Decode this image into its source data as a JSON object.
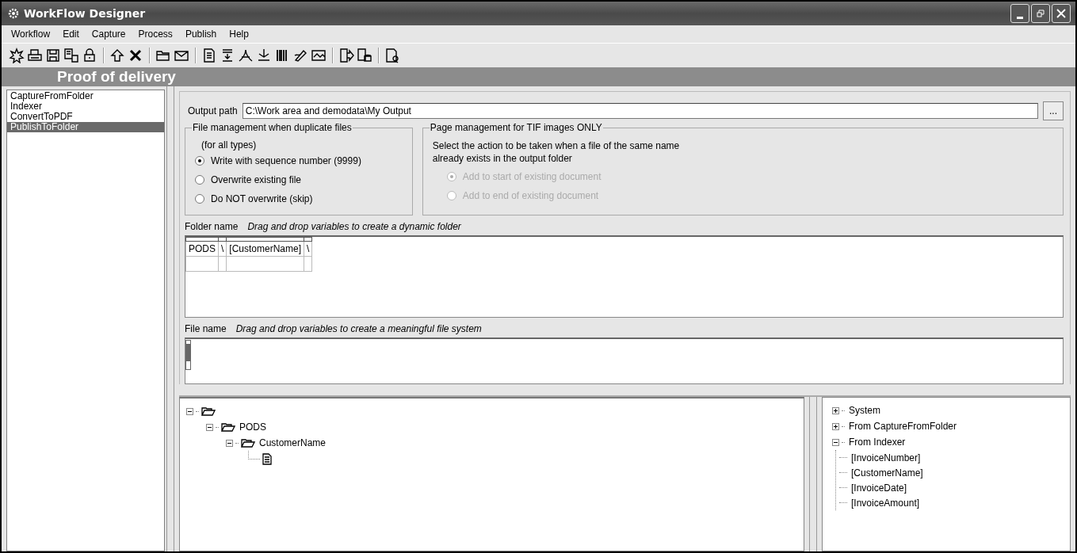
{
  "window": {
    "title": "WorkFlow Designer"
  },
  "menu": [
    "Workflow",
    "Edit",
    "Capture",
    "Process",
    "Publish",
    "Help"
  ],
  "header": {
    "title": "Proof of delivery"
  },
  "steps": [
    {
      "label": "CaptureFromFolder",
      "selected": false
    },
    {
      "label": "Indexer",
      "selected": false
    },
    {
      "label": "ConvertToPDF",
      "selected": false
    },
    {
      "label": "PublishToFolder",
      "selected": true
    }
  ],
  "output_path": {
    "label": "Output path",
    "value": "C:\\Work area and demodata\\My Output",
    "browse": "..."
  },
  "duplicates": {
    "title": "File management when duplicate files",
    "note": "(for all types)",
    "options": [
      {
        "label": "Write with sequence number (9999)",
        "selected": true
      },
      {
        "label": "Overwrite existing file",
        "selected": false
      },
      {
        "label": "Do NOT overwrite (skip)",
        "selected": false
      }
    ]
  },
  "tif": {
    "title": "Page management for TIF images ONLY",
    "description": "Select the action to be taken when a file of the same name already exists in the output folder",
    "disabled": true,
    "options": [
      {
        "label": "Add to start of existing document",
        "selected": true
      },
      {
        "label": "Add to end of existing document",
        "selected": false
      }
    ]
  },
  "folder_name": {
    "label": "Folder name",
    "hint": "Drag and drop variables to create a dynamic folder",
    "segments": [
      "PODS",
      "\\",
      "[CustomerName]",
      "\\"
    ]
  },
  "file_name": {
    "label": "File name",
    "hint": "Drag and drop variables to create a meaningful file system"
  },
  "folder_tree": [
    {
      "kind": "folder",
      "expanded": true,
      "children": [
        {
          "kind": "folder",
          "label": "PODS",
          "expanded": true,
          "children": [
            {
              "kind": "folder",
              "label": "CustomerName",
              "expanded": true,
              "children": [
                {
                  "kind": "file"
                }
              ]
            }
          ]
        }
      ]
    }
  ],
  "variables": [
    {
      "label": "System",
      "expanded": false
    },
    {
      "label": "From CaptureFromFolder",
      "expanded": false
    },
    {
      "label": "From Indexer",
      "expanded": true,
      "children": [
        {
          "label": "[InvoiceNumber]"
        },
        {
          "label": "[CustomerName]"
        },
        {
          "label": "[InvoiceDate]"
        },
        {
          "label": "[InvoiceAmount]"
        }
      ]
    }
  ]
}
